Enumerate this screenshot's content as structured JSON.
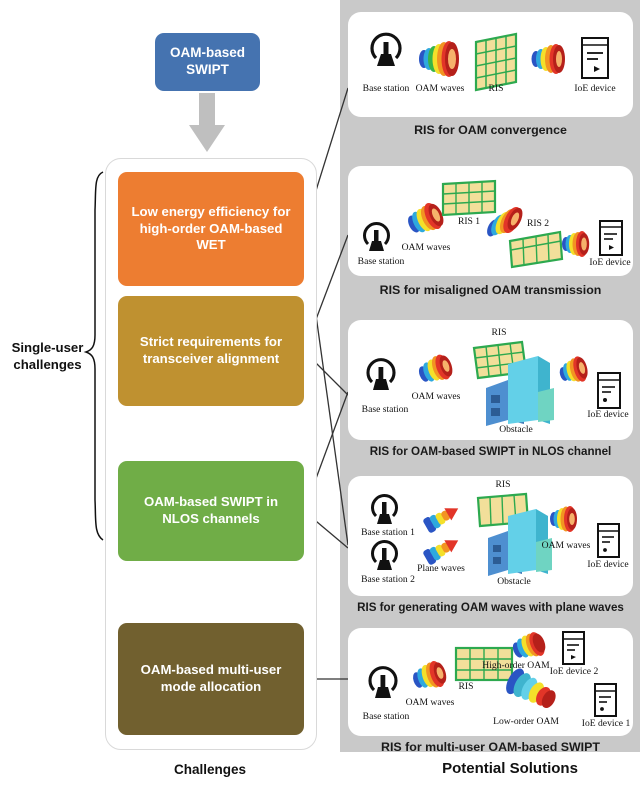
{
  "title_box": {
    "label": "OAM-based SWIPT",
    "color": "#4573B0"
  },
  "columns": {
    "left_label": "Challenges",
    "right_label": "Potential Solutions",
    "bracket_label": "Single-user challenges"
  },
  "challenges": [
    {
      "id": "low-energy-efficiency",
      "label": "Low energy efficiency for high-order OAM-based WET",
      "color": "#ED7D31"
    },
    {
      "id": "transceiver-alignment",
      "label": "Strict requirements for transceiver alignment",
      "color": "#BF9130"
    },
    {
      "id": "nlos-channels",
      "label": "OAM-based SWIPT in NLOS channels",
      "color": "#70AD47"
    },
    {
      "id": "multi-user-mode-allocation",
      "label": "OAM-based multi-user mode allocation",
      "color": "#71602F"
    }
  ],
  "solutions": [
    {
      "id": "ris-oam-convergence",
      "caption": "RIS for OAM convergence",
      "icon_labels": [
        "Base station",
        "OAM waves",
        "RIS",
        "IoE device"
      ]
    },
    {
      "id": "ris-misaligned-oam",
      "caption": "RIS for misaligned OAM transmission",
      "icon_labels": [
        "RIS 1",
        "OAM waves",
        "Base station",
        "RIS 2",
        "IoE device"
      ]
    },
    {
      "id": "ris-swipt-nlos",
      "caption": "RIS for OAM-based SWIPT in NLOS channel",
      "icon_labels": [
        "RIS",
        "OAM waves",
        "Base station",
        "Obstacle",
        "IoE device"
      ]
    },
    {
      "id": "ris-generating-oam-plane",
      "caption": "RIS for generating OAM waves with plane waves",
      "icon_labels": [
        "RIS",
        "Base station 1",
        "Plane waves",
        "Base station 2",
        "Obstacle",
        "OAM waves",
        "IoE device"
      ]
    },
    {
      "id": "ris-multiuser-swipt",
      "caption": "RIS for multi-user OAM-based SWIPT",
      "icon_labels": [
        "RIS",
        "OAM waves",
        "Base station",
        "High-order OAM",
        "Low-order OAM",
        "IoE device 2",
        "IoE device 1"
      ]
    }
  ],
  "palette": {
    "grey_column": "#c9c9c9",
    "arrow": "#bfbfbf",
    "ris_fill": "#F2DF9A",
    "ris_stroke": "#2DA94F",
    "obstacle": "#4FC3DC",
    "connector": "#333333"
  }
}
